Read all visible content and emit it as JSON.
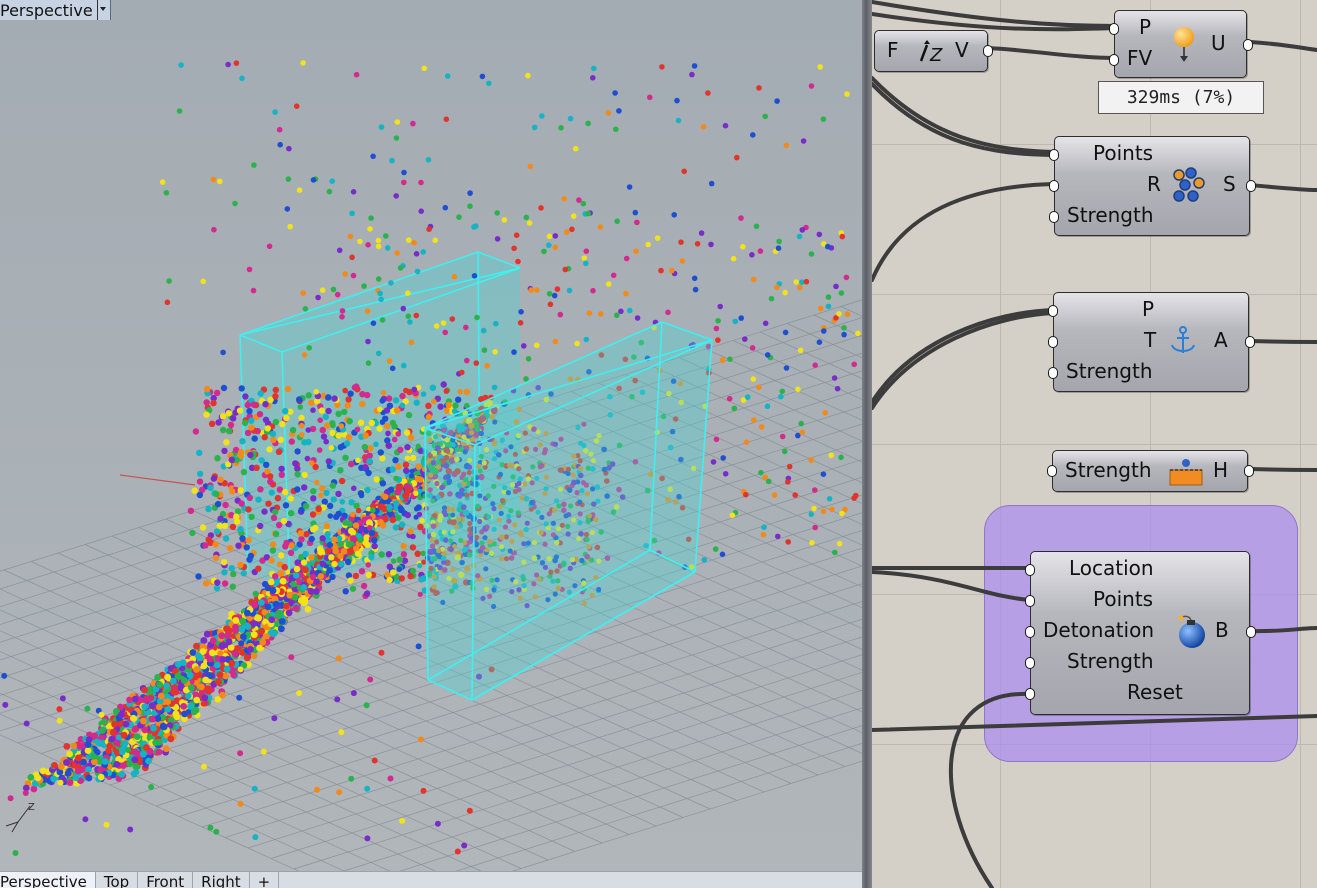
{
  "viewport": {
    "title": "Perspective",
    "tabs": [
      {
        "label": "Perspective",
        "active": true
      },
      {
        "label": "Top",
        "active": false
      },
      {
        "label": "Front",
        "active": false
      },
      {
        "label": "Right",
        "active": false
      },
      {
        "label": "+",
        "active": false
      }
    ],
    "axis_label": "Z"
  },
  "canvas": {
    "value_node": {
      "left": "F",
      "right": "V"
    },
    "unary_force": {
      "inputs": [
        "P",
        "FV"
      ],
      "output": "U",
      "icon": "pin-force-icon"
    },
    "profiler": "329ms (7%)",
    "collide": {
      "inputs": [
        "Points",
        "R",
        "Strength"
      ],
      "output": "S",
      "icon": "sphere-collide-icon"
    },
    "anchor": {
      "inputs": [
        "P",
        "T",
        "Strength"
      ],
      "output": "A",
      "icon": "anchor-icon"
    },
    "floor": {
      "inputs": [
        "Strength"
      ],
      "output": "H",
      "icon": "floor-icon"
    },
    "bomb": {
      "inputs": [
        "Location",
        "Points",
        "Detonation",
        "Strength",
        "Reset"
      ],
      "output": "B",
      "icon": "bomb-icon"
    }
  },
  "colors": {
    "viewport_bg": "#a9b0b6",
    "box_edge": "#3ff0f0",
    "group_fill": "#aa8cf0",
    "particles": [
      "#e0342c",
      "#f28a1a",
      "#f2e21b",
      "#2bb24c",
      "#1f4fd1",
      "#7a2cc9",
      "#d22a8f",
      "#16b3c4"
    ]
  }
}
